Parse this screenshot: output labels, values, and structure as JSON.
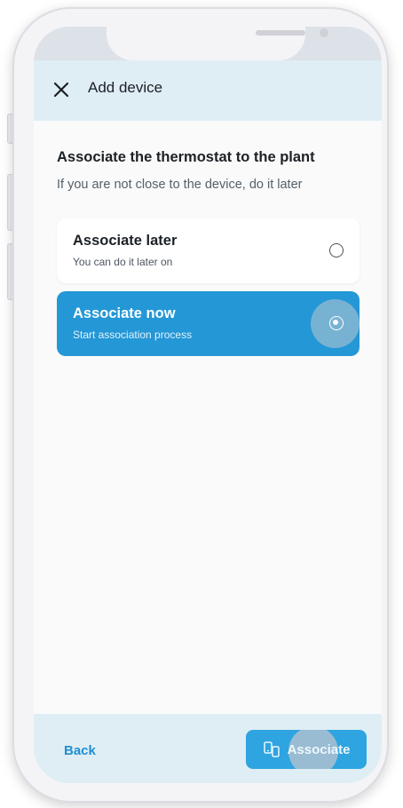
{
  "header": {
    "title": "Add device"
  },
  "main": {
    "title": "Associate the thermostat to the plant",
    "subtitle": "If you are not close to the device, do it later",
    "options": [
      {
        "title": "Associate later",
        "subtitle": "You can do it later on",
        "selected": false
      },
      {
        "title": "Associate now",
        "subtitle": "Start association process",
        "selected": true
      }
    ]
  },
  "footer": {
    "back_label": "Back",
    "associate_label": "Associate"
  },
  "colors": {
    "accent": "#2497d6",
    "header_bg": "#dfeef5",
    "link": "#1f8fd1"
  },
  "icons": {
    "close": "close-icon",
    "associate": "devices-icon"
  }
}
